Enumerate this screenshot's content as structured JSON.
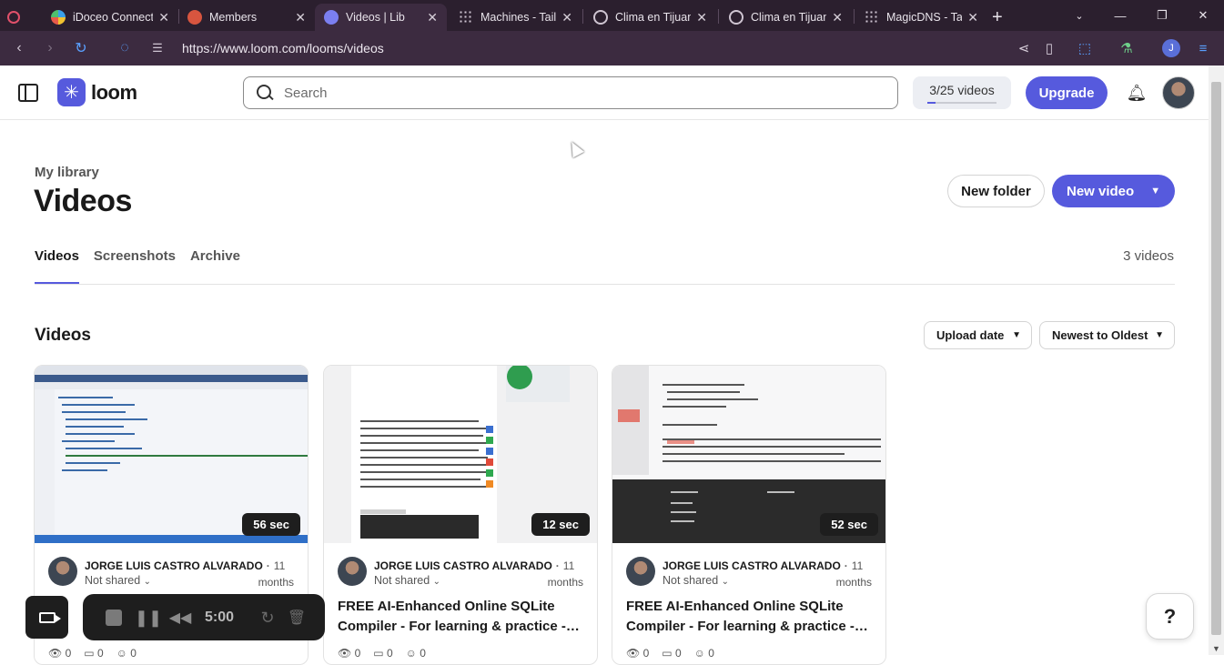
{
  "browser": {
    "tabs": [
      {
        "title": "iDoceo Connect",
        "favicon_color": "#e9e9e9"
      },
      {
        "title": "Members",
        "favicon_color": "#d8553f"
      },
      {
        "title": "Videos | Lib",
        "favicon_color": "#7b7ff0"
      },
      {
        "title": "Machines - Tails",
        "favicon_color": "#cfc5d2"
      },
      {
        "title": "Clima en Tijuan",
        "favicon_color": "#cfc5d2"
      },
      {
        "title": "Clima en Tijuan",
        "favicon_color": "#cfc5d2"
      },
      {
        "title": "MagicDNS - Tail",
        "favicon_color": "#cfc5d2"
      }
    ],
    "url": "https://www.loom.com/looms/videos"
  },
  "header": {
    "logo_text": "loom",
    "search_placeholder": "Search",
    "quota_label": "3/25 videos",
    "quota_fraction": 0.12,
    "upgrade_label": "Upgrade"
  },
  "page": {
    "eyebrow": "My library",
    "title": "Videos",
    "new_folder_label": "New folder",
    "new_video_label": "New video",
    "tabs": [
      {
        "label": "Videos"
      },
      {
        "label": "Screenshots"
      },
      {
        "label": "Archive"
      }
    ],
    "count_label": "3 videos",
    "section_title": "Videos",
    "sort_field": "Upload date",
    "sort_order": "Newest to Oldest"
  },
  "videos": [
    {
      "duration": "56 sec",
      "author": "JORGE LUIS CASTRO ALVARADO",
      "age_number": "11",
      "age_unit": "months",
      "sharing": "Not shared",
      "title": "",
      "views": "0",
      "comments": "0",
      "reactions": "0"
    },
    {
      "duration": "12 sec",
      "author": "JORGE LUIS CASTRO ALVARADO",
      "age_number": "11",
      "age_unit": "months",
      "sharing": "Not shared",
      "title": "FREE AI-Enhanced Online SQLite Compiler - For learning & practice -…",
      "views": "0",
      "comments": "0",
      "reactions": "0"
    },
    {
      "duration": "52 sec",
      "author": "JORGE LUIS CASTRO ALVARADO",
      "age_number": "11",
      "age_unit": "months",
      "sharing": "Not shared",
      "title": "FREE AI-Enhanced Online SQLite Compiler - For learning & practice -…",
      "views": "0",
      "comments": "0",
      "reactions": "0"
    }
  ],
  "recorder": {
    "timer": "5:00"
  },
  "help_label": "?",
  "colors": {
    "accent": "#565add",
    "browser_bg": "#2b1f2e"
  }
}
